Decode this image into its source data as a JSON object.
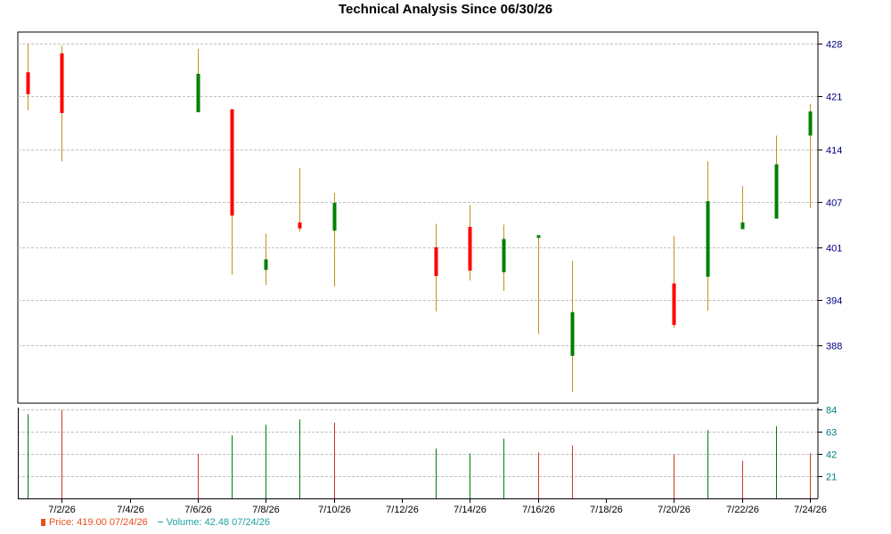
{
  "title": "Technical Analysis Since 06/30/26",
  "colors": {
    "up": "#008000",
    "down": "#ff0000",
    "wick": "#c8901c",
    "grid": "#c0c0c0",
    "axis": "#000000",
    "price_tick": "#000080",
    "volume_tick": "#008080",
    "volume_up": "#008000",
    "volume_down": "#c83c1c",
    "legend_price": "#e8501c",
    "legend_volume": "#20a0a0"
  },
  "legend": {
    "price": "Price: 419.00  07/24/26",
    "volume": "Volume: 42.48  07/24/26"
  },
  "chart_data": [
    {
      "type": "candlestick",
      "panel": "price",
      "yticks": [
        388,
        394,
        401,
        407,
        414,
        421,
        428
      ],
      "ylim": [
        381,
        428
      ],
      "xlim": [
        "2026-06-30",
        "2026-07-24"
      ],
      "xticks": [
        "7/2/26",
        "7/4/26",
        "7/6/26",
        "7/8/26",
        "7/10/26",
        "7/12/26",
        "7/14/26",
        "7/16/26",
        "7/18/26",
        "7/20/26",
        "7/22/26",
        "7/24/26"
      ],
      "grid": true,
      "candles": [
        {
          "date": "2026-07-01",
          "open": 424.2,
          "high": 428.0,
          "low": 419.2,
          "close": 421.3
        },
        {
          "date": "2026-07-02",
          "open": 426.7,
          "high": 427.7,
          "low": 412.4,
          "close": 418.8
        },
        {
          "date": "2026-07-06",
          "open": 418.9,
          "high": 427.3,
          "low": 418.9,
          "close": 424.0
        },
        {
          "date": "2026-07-07",
          "open": 419.3,
          "high": 419.3,
          "low": 397.4,
          "close": 405.2
        },
        {
          "date": "2026-07-08",
          "open": 398.0,
          "high": 402.8,
          "low": 396.0,
          "close": 399.4
        },
        {
          "date": "2026-07-09",
          "open": 404.3,
          "high": 411.5,
          "low": 403.1,
          "close": 403.5
        },
        {
          "date": "2026-07-10",
          "open": 403.2,
          "high": 408.2,
          "low": 395.8,
          "close": 406.9
        },
        {
          "date": "2026-07-13",
          "open": 401.0,
          "high": 404.1,
          "low": 392.5,
          "close": 397.2
        },
        {
          "date": "2026-07-14",
          "open": 403.7,
          "high": 406.6,
          "low": 396.6,
          "close": 397.9
        },
        {
          "date": "2026-07-15",
          "open": 397.7,
          "high": 404.0,
          "low": 395.2,
          "close": 402.1
        },
        {
          "date": "2026-07-16",
          "open": 402.6,
          "high": 402.6,
          "low": 389.5,
          "close": 402.6
        },
        {
          "date": "2026-07-17",
          "open": 386.6,
          "high": 399.2,
          "low": 381.8,
          "close": 392.4
        },
        {
          "date": "2026-07-20",
          "open": 396.2,
          "high": 402.5,
          "low": 390.3,
          "close": 390.7
        },
        {
          "date": "2026-07-21",
          "open": 397.1,
          "high": 412.4,
          "low": 392.6,
          "close": 407.1
        },
        {
          "date": "2026-07-22",
          "open": 403.4,
          "high": 409.1,
          "low": 403.4,
          "close": 404.3
        },
        {
          "date": "2026-07-23",
          "open": 404.8,
          "high": 415.8,
          "low": 404.8,
          "close": 412.0
        },
        {
          "date": "2026-07-24",
          "open": 415.8,
          "high": 420.0,
          "low": 406.2,
          "close": 419.0
        }
      ]
    },
    {
      "type": "bar",
      "panel": "volume",
      "yticks": [
        21,
        42,
        63,
        84
      ],
      "ylim": [
        0,
        84
      ],
      "grid": true,
      "bars": [
        {
          "date": "2026-07-01",
          "value": 79.5,
          "direction": "up"
        },
        {
          "date": "2026-07-02",
          "value": 83.5,
          "direction": "down"
        },
        {
          "date": "2026-07-06",
          "value": 42.0,
          "direction": "down"
        },
        {
          "date": "2026-07-07",
          "value": 59.5,
          "direction": "up"
        },
        {
          "date": "2026-07-08",
          "value": 69.5,
          "direction": "up"
        },
        {
          "date": "2026-07-09",
          "value": 74.5,
          "direction": "up"
        },
        {
          "date": "2026-07-10",
          "value": 71.5,
          "direction": "down"
        },
        {
          "date": "2026-07-13",
          "value": 47.0,
          "direction": "up"
        },
        {
          "date": "2026-07-14",
          "value": 42.5,
          "direction": "up"
        },
        {
          "date": "2026-07-15",
          "value": 56.5,
          "direction": "up"
        },
        {
          "date": "2026-07-16",
          "value": 43.5,
          "direction": "down"
        },
        {
          "date": "2026-07-17",
          "value": 50.0,
          "direction": "down"
        },
        {
          "date": "2026-07-20",
          "value": 41.5,
          "direction": "down"
        },
        {
          "date": "2026-07-21",
          "value": 64.5,
          "direction": "up"
        },
        {
          "date": "2026-07-22",
          "value": 35.5,
          "direction": "down"
        },
        {
          "date": "2026-07-23",
          "value": 68.0,
          "direction": "up"
        },
        {
          "date": "2026-07-24",
          "value": 42.5,
          "direction": "down"
        }
      ]
    }
  ]
}
